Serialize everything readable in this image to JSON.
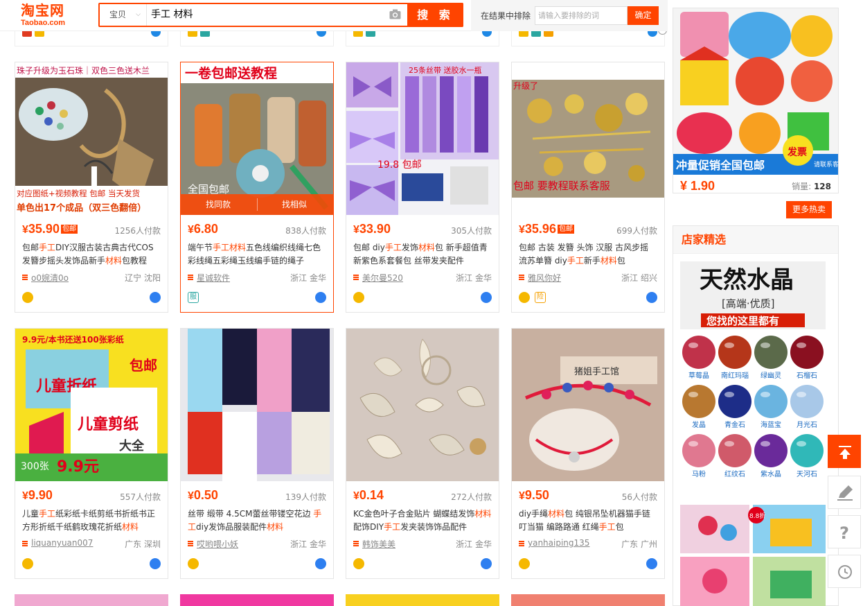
{
  "header": {
    "logo_main": "淘宝网",
    "logo_sub": "Taobao.com",
    "search_type": "宝贝",
    "search_query": "手工 材料",
    "search_button": "搜 索",
    "exclude_label": "在结果中排除",
    "exclude_placeholder": "请输入要排除的词",
    "exclude_button": "确定"
  },
  "products": [
    {
      "price": "35.90",
      "baoyou": "包邮",
      "paid": "1256人付款",
      "title_html": "包邮<em>手工</em>DIY汉服古装古典古代COS发簪步摇头发饰品新手<em>材料</em>包教程",
      "shop": "o0婉清0o",
      "location": "辽宁 沈阳"
    },
    {
      "price": "6.80",
      "baoyou": "",
      "paid": "838人付款",
      "title_html": "端午节<em>手工材料</em>五色线编织线绳七色彩线绳五彩绳玉线编手链的绳子",
      "shop": "星诚软件",
      "location": "浙江 金华"
    },
    {
      "price": "33.90",
      "baoyou": "",
      "paid": "305人付款",
      "title_html": "包邮 diy<em>手工</em>发饰<em>材料</em>包 新手超值青新紫色系套餐包 丝带发夹配件",
      "shop": "美尔曼520",
      "location": "浙江 金华"
    },
    {
      "price": "35.96",
      "baoyou": "包邮",
      "paid": "699人付款",
      "title_html": "包邮 古装 发簪 头饰 汉服 古风步摇 流苏单簪 diy<em>手工</em>新手<em>材料</em>包",
      "shop": "雅风你好",
      "location": "浙江 绍兴"
    },
    {
      "price": "9.90",
      "baoyou": "",
      "paid": "557人付款",
      "title_html": "儿童<em>手工</em>纸彩纸卡纸剪纸书折纸书正方形折纸千纸鹤玫瑰花折纸<em>材料</em>",
      "shop": "liquanyuan007",
      "location": "广东 深圳"
    },
    {
      "price": "0.50",
      "baoyou": "",
      "paid": "139人付款",
      "title_html": "丝带 缎带 4.5CM蕾丝带镂空花边 <em>手工</em>diy发饰品服装配件<em>材料</em>",
      "shop": "哎哟喂小妖",
      "location": "浙江 金华"
    },
    {
      "price": "0.14",
      "baoyou": "",
      "paid": "272人付款",
      "title_html": "KC金色叶子合金贴片 蝴蝶结发饰<em>材料</em>配饰DIY<em>手工</em>发夹装饰饰品配件",
      "shop": "韩饰美美",
      "location": "浙江 金华"
    },
    {
      "price": "9.50",
      "baoyou": "",
      "paid": "56人付款",
      "title_html": "diy手绳<em>材料</em>包 纯银吊坠机器猫手链叮当猫 编路路通 红绳<em>手工</em>包",
      "shop": "yanhaiping135",
      "location": "广东 广州"
    }
  ],
  "image_texts": {
    "p1_top": "珠子升级为玉石珠｜双色三色送木兰",
    "p1_mid": "对应图纸+视频教程  包邮  当天发货",
    "p1_bot": "单色出17个成品（双三色翻倍）",
    "p2_top": "一卷包邮送教程",
    "p2_corner": "全国包邮",
    "p3_top": "25条丝带 送胶水一瓶",
    "p3_mid": "19.8 包邮",
    "p4_top": "升级了",
    "p4_bot": "包邮  要教程联系客服",
    "p5_top": "9.9元/本书还送100张彩纸",
    "p5_a": "儿童折纸",
    "p5_b": "包邮",
    "p5_c": "儿童剪纸",
    "p5_d": "大全",
    "p5_e": "300张",
    "p5_f": "9.9元",
    "p8_sign": "猪姐手工馆",
    "ad_banner": "冲量促销全国包邮",
    "ad_fapiao": "发票",
    "ad_kefu": "请联系客服",
    "crystal_title": "天然水晶",
    "crystal_sub": "[高端·优质]",
    "crystal_banner": "您找的这里都有",
    "crystal2_tag": "8.8折"
  },
  "hover_bar": {
    "left": "找同款",
    "right": "找相似"
  },
  "ad": {
    "price": "1.90",
    "sales_label": "销量:",
    "sales_value": "128"
  },
  "more_hot": "更多热卖",
  "shop_pick_title": "店家精选",
  "crystals": [
    {
      "name": "草莓晶",
      "color": "#c0324a"
    },
    {
      "name": "南红玛瑙",
      "color": "#b5361a"
    },
    {
      "name": "绿幽灵",
      "color": "#5b6a4a"
    },
    {
      "name": "石榴石",
      "color": "#8a1020"
    },
    {
      "name": "发晶",
      "color": "#b87830"
    },
    {
      "name": "青金石",
      "color": "#1d2d88"
    },
    {
      "name": "海蓝宝",
      "color": "#6ab4e0"
    },
    {
      "name": "月光石",
      "color": "#a8c8e8"
    },
    {
      "name": "马粉",
      "color": "#e07890"
    },
    {
      "name": "红纹石",
      "color": "#d05a6a"
    },
    {
      "name": "紫水晶",
      "color": "#6a2a9a"
    },
    {
      "name": "天河石",
      "color": "#30b8b8"
    }
  ],
  "colors": {
    "accent": "#ff4400",
    "wangwang": "#2e7ff0"
  }
}
